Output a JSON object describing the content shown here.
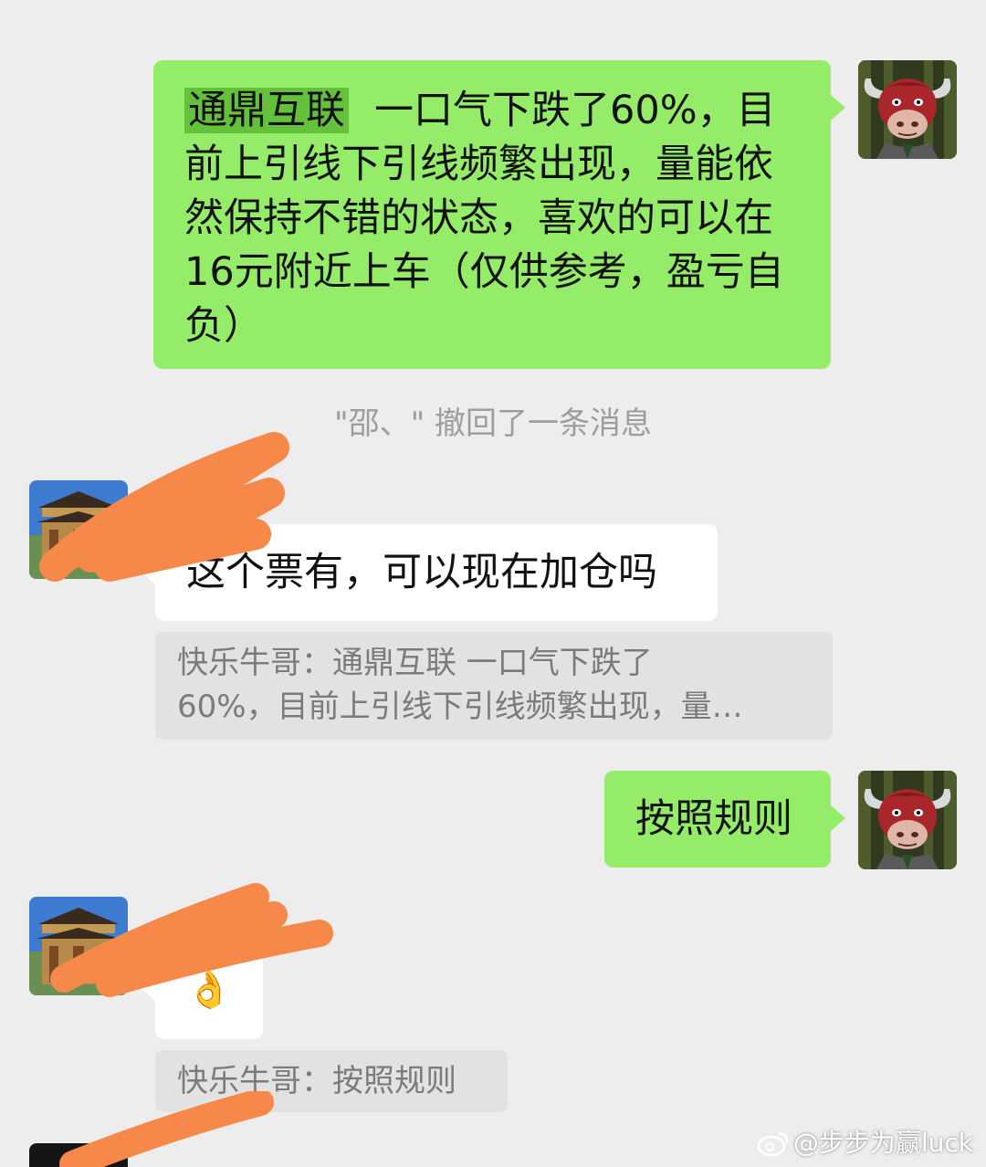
{
  "messages": {
    "first": {
      "highlight": "通鼎互联",
      "line1_rest": "一口气下跌了60%，目",
      "line2": "前上引线下引线频繁出现，量能依",
      "line3": "然保持不错的状态，喜欢的可以在",
      "line4": "16元附近上车（仅供参考，盈亏自",
      "line5": "负）"
    },
    "recall_notice": "\"邵、\" 撤回了一条消息",
    "question": "这个票有，可以现在加仓吗",
    "quote1": {
      "line1": "快乐牛哥：通鼎互联  一口气下跌了",
      "line2": "60%，目前上引线下引线频繁出现，量…"
    },
    "reply": "按照规则",
    "ok_emoji": "👌",
    "quote2": "快乐牛哥：按照规则"
  },
  "watermark": "@步步为赢luck",
  "colors": {
    "background": "#ededed",
    "green_bubble": "#95ec69",
    "highlight": "#63c13c",
    "scribble": "#f6894a"
  }
}
